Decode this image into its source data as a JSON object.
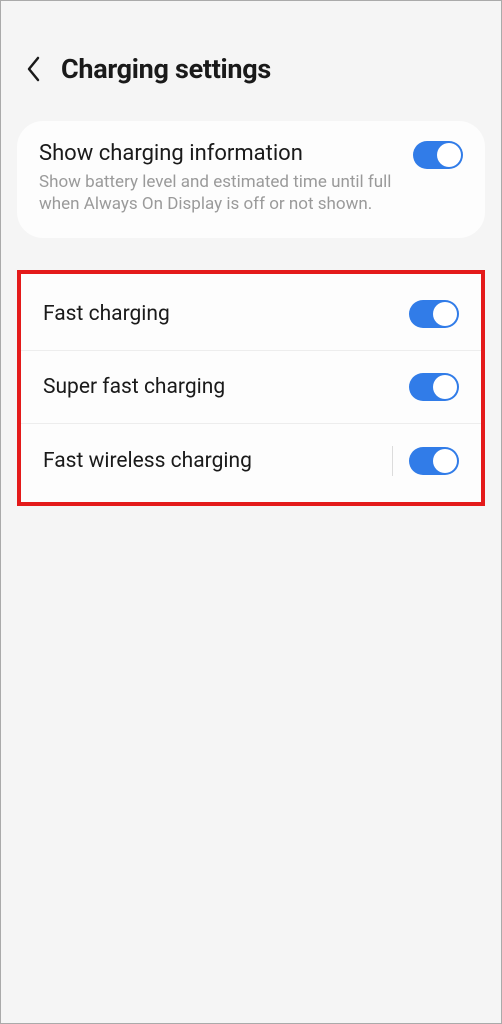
{
  "header": {
    "title": "Charging settings"
  },
  "main_card": {
    "title": "Show charging information",
    "subtitle": "Show battery level and estimated time until full when Always On Display is off or not shown.",
    "toggle_on": true
  },
  "fast_group": {
    "highlight_color": "#e41a1a",
    "items": [
      {
        "key": "fast-charging",
        "label": "Fast charging",
        "toggle_on": true,
        "has_divider": false
      },
      {
        "key": "super-fast-charging",
        "label": "Super fast charging",
        "toggle_on": true,
        "has_divider": false
      },
      {
        "key": "fast-wireless-charging",
        "label": "Fast wireless charging",
        "toggle_on": true,
        "has_divider": true
      }
    ]
  },
  "icons": {
    "back": "chevron-left"
  },
  "colors": {
    "accent": "#317ce8",
    "bg": "#f5f5f5",
    "card": "#fdfdfd"
  }
}
